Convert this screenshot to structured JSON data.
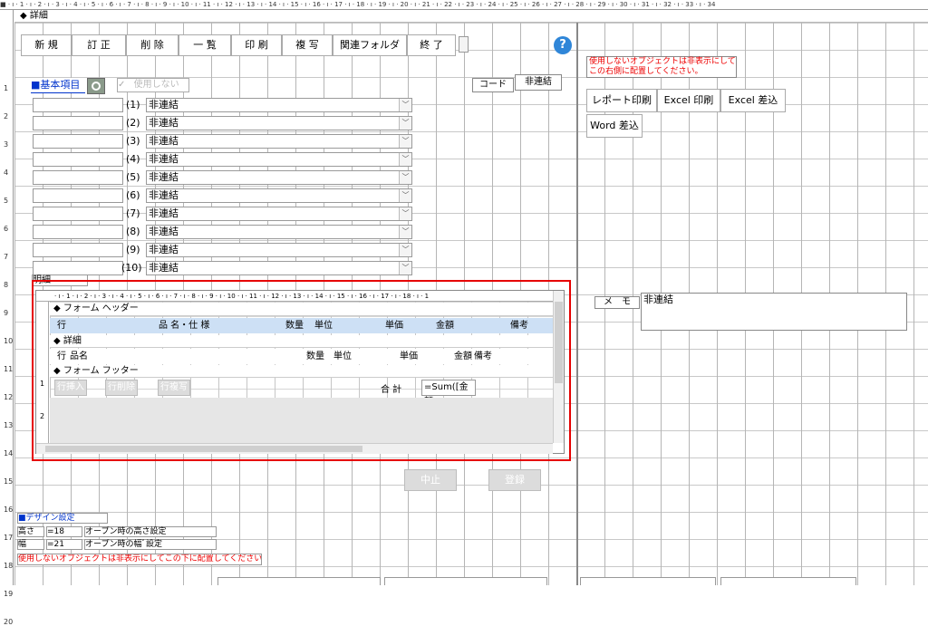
{
  "ruler": {
    "marks": "■ · ı · 1 · ı · 2 · ı · 3 · ı · 4 · ı · 5 · ı · 6 · ı · 7 · ı · 8 · ı · 9 · ı · 10 · ı · 11 · ı · 12 · ı · 13 · ı · 14 · ı · 15 · ı · 16 · ı · 17 · ı · 18 · ı · 19 · ı · 20 · ı · 21 · ı · 22 · ı · 23 · ı · 24 · ı · 25 · ı · 26 · ı · 27 · ı · 28 · ı · 29 · ı · 30 · ı · 31 · ı · 32 · ı · 33 · ı · 34",
    "vertical": [
      "1",
      "2",
      "3",
      "4",
      "5",
      "6",
      "7",
      "8",
      "9",
      "10",
      "11",
      "12",
      "13",
      "14",
      "15",
      "16",
      "17",
      "18",
      "19",
      "20"
    ]
  },
  "section_title": "◆ 詳細",
  "toolbar": {
    "new": "新 規",
    "edit": "訂 正",
    "delete": "削 除",
    "list": "一 覧",
    "print": "印 刷",
    "copy": "複 写",
    "folder": "関連フォルダ",
    "exit": "終 了",
    "help": "?"
  },
  "note_top": "使用しないオブジェクトは非表示にして\nこの右側に配置してください。",
  "basic": {
    "title": "■基本項目",
    "use_label": "使用しない",
    "code_label": "コード",
    "code_value": "非連結"
  },
  "report": {
    "report_print": "レポート印刷",
    "excel_print": "Excel 印刷",
    "excel_merge": "Excel 差込",
    "word_merge": "Word 差込"
  },
  "fields": [
    {
      "no": "(1)",
      "value": "非連結"
    },
    {
      "no": "(2)",
      "value": "非連結"
    },
    {
      "no": "(3)",
      "value": "非連結"
    },
    {
      "no": "(4)",
      "value": "非連結"
    },
    {
      "no": "(5)",
      "value": "非連結"
    },
    {
      "no": "(6)",
      "value": "非連結"
    },
    {
      "no": "(7)",
      "value": "非連結"
    },
    {
      "no": "(8)",
      "value": "非連結"
    },
    {
      "no": "(9)",
      "value": "非連結"
    },
    {
      "no": "(10)",
      "value": "非連結"
    }
  ],
  "detail_label": "明細",
  "memo": {
    "label": "メ　モ",
    "value": "非連結"
  },
  "subform": {
    "ruler": "· ı · 1 · ı · 2 · ı · 3 · ı · 4 · ı · 5 · ı · 6 · ı · 7 · ı · 8 · ı · 9 · ı · 10 · ı · 11 · ı · 12 · ı · 13 · ı · 14 · ı · 15 · ı · 16 · ı · 17 · ı · 18 · ı · 1",
    "form_header": "◆ フォーム ヘッダー",
    "header_cols": {
      "row": "行",
      "item": "品 名・仕 様",
      "qty": "数量",
      "unit": "単位",
      "price": "単価",
      "amount": "金額",
      "note": "備考"
    },
    "detail": "◆ 詳細",
    "detail_cols": {
      "row": "行",
      "item": "品名",
      "qty": "数量",
      "unit": "単位",
      "price": "単価",
      "amount": "金額",
      "note": "備考"
    },
    "form_footer": "◆ フォーム フッター",
    "footer": {
      "insert": "行挿入",
      "delete": "行削除",
      "copy": "行複写",
      "total_label": "合 計",
      "total_expr": "=Sum([金額"
    },
    "vr": [
      "1",
      "2"
    ]
  },
  "actions": {
    "cancel": "中止",
    "register": "登録"
  },
  "design": {
    "title": "■デザイン設定",
    "height_label": "高さ",
    "height_value": "=18",
    "height_note": "オープン時の高さ設定",
    "width_label": "幅",
    "width_value": "=21",
    "width_note": "オープン時の幅ﾞ設定",
    "note": "使用しないオブジェクトは非表示にしてこの下に配置してください。"
  },
  "colors": {
    "highlight": "#e60000",
    "title_blue": "#0033cc",
    "subform_header": "#cde0f5"
  }
}
